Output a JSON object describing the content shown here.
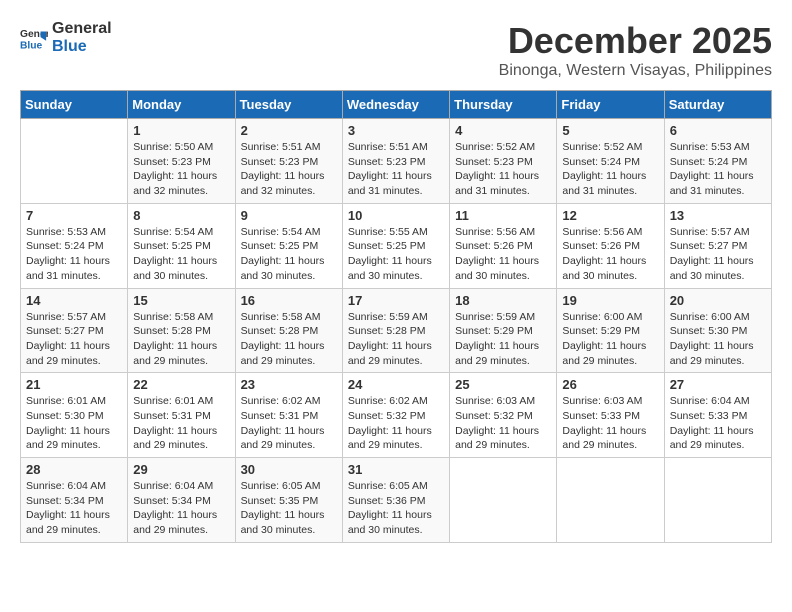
{
  "logo": {
    "line1": "General",
    "line2": "Blue"
  },
  "title": "December 2025",
  "subtitle": "Binonga, Western Visayas, Philippines",
  "weekdays": [
    "Sunday",
    "Monday",
    "Tuesday",
    "Wednesday",
    "Thursday",
    "Friday",
    "Saturday"
  ],
  "weeks": [
    [
      {
        "day": "",
        "sunrise": "",
        "sunset": "",
        "daylight": ""
      },
      {
        "day": "1",
        "sunrise": "Sunrise: 5:50 AM",
        "sunset": "Sunset: 5:23 PM",
        "daylight": "Daylight: 11 hours and 32 minutes."
      },
      {
        "day": "2",
        "sunrise": "Sunrise: 5:51 AM",
        "sunset": "Sunset: 5:23 PM",
        "daylight": "Daylight: 11 hours and 32 minutes."
      },
      {
        "day": "3",
        "sunrise": "Sunrise: 5:51 AM",
        "sunset": "Sunset: 5:23 PM",
        "daylight": "Daylight: 11 hours and 31 minutes."
      },
      {
        "day": "4",
        "sunrise": "Sunrise: 5:52 AM",
        "sunset": "Sunset: 5:23 PM",
        "daylight": "Daylight: 11 hours and 31 minutes."
      },
      {
        "day": "5",
        "sunrise": "Sunrise: 5:52 AM",
        "sunset": "Sunset: 5:24 PM",
        "daylight": "Daylight: 11 hours and 31 minutes."
      },
      {
        "day": "6",
        "sunrise": "Sunrise: 5:53 AM",
        "sunset": "Sunset: 5:24 PM",
        "daylight": "Daylight: 11 hours and 31 minutes."
      }
    ],
    [
      {
        "day": "7",
        "sunrise": "Sunrise: 5:53 AM",
        "sunset": "Sunset: 5:24 PM",
        "daylight": "Daylight: 11 hours and 31 minutes."
      },
      {
        "day": "8",
        "sunrise": "Sunrise: 5:54 AM",
        "sunset": "Sunset: 5:25 PM",
        "daylight": "Daylight: 11 hours and 30 minutes."
      },
      {
        "day": "9",
        "sunrise": "Sunrise: 5:54 AM",
        "sunset": "Sunset: 5:25 PM",
        "daylight": "Daylight: 11 hours and 30 minutes."
      },
      {
        "day": "10",
        "sunrise": "Sunrise: 5:55 AM",
        "sunset": "Sunset: 5:25 PM",
        "daylight": "Daylight: 11 hours and 30 minutes."
      },
      {
        "day": "11",
        "sunrise": "Sunrise: 5:56 AM",
        "sunset": "Sunset: 5:26 PM",
        "daylight": "Daylight: 11 hours and 30 minutes."
      },
      {
        "day": "12",
        "sunrise": "Sunrise: 5:56 AM",
        "sunset": "Sunset: 5:26 PM",
        "daylight": "Daylight: 11 hours and 30 minutes."
      },
      {
        "day": "13",
        "sunrise": "Sunrise: 5:57 AM",
        "sunset": "Sunset: 5:27 PM",
        "daylight": "Daylight: 11 hours and 30 minutes."
      }
    ],
    [
      {
        "day": "14",
        "sunrise": "Sunrise: 5:57 AM",
        "sunset": "Sunset: 5:27 PM",
        "daylight": "Daylight: 11 hours and 29 minutes."
      },
      {
        "day": "15",
        "sunrise": "Sunrise: 5:58 AM",
        "sunset": "Sunset: 5:28 PM",
        "daylight": "Daylight: 11 hours and 29 minutes."
      },
      {
        "day": "16",
        "sunrise": "Sunrise: 5:58 AM",
        "sunset": "Sunset: 5:28 PM",
        "daylight": "Daylight: 11 hours and 29 minutes."
      },
      {
        "day": "17",
        "sunrise": "Sunrise: 5:59 AM",
        "sunset": "Sunset: 5:28 PM",
        "daylight": "Daylight: 11 hours and 29 minutes."
      },
      {
        "day": "18",
        "sunrise": "Sunrise: 5:59 AM",
        "sunset": "Sunset: 5:29 PM",
        "daylight": "Daylight: 11 hours and 29 minutes."
      },
      {
        "day": "19",
        "sunrise": "Sunrise: 6:00 AM",
        "sunset": "Sunset: 5:29 PM",
        "daylight": "Daylight: 11 hours and 29 minutes."
      },
      {
        "day": "20",
        "sunrise": "Sunrise: 6:00 AM",
        "sunset": "Sunset: 5:30 PM",
        "daylight": "Daylight: 11 hours and 29 minutes."
      }
    ],
    [
      {
        "day": "21",
        "sunrise": "Sunrise: 6:01 AM",
        "sunset": "Sunset: 5:30 PM",
        "daylight": "Daylight: 11 hours and 29 minutes."
      },
      {
        "day": "22",
        "sunrise": "Sunrise: 6:01 AM",
        "sunset": "Sunset: 5:31 PM",
        "daylight": "Daylight: 11 hours and 29 minutes."
      },
      {
        "day": "23",
        "sunrise": "Sunrise: 6:02 AM",
        "sunset": "Sunset: 5:31 PM",
        "daylight": "Daylight: 11 hours and 29 minutes."
      },
      {
        "day": "24",
        "sunrise": "Sunrise: 6:02 AM",
        "sunset": "Sunset: 5:32 PM",
        "daylight": "Daylight: 11 hours and 29 minutes."
      },
      {
        "day": "25",
        "sunrise": "Sunrise: 6:03 AM",
        "sunset": "Sunset: 5:32 PM",
        "daylight": "Daylight: 11 hours and 29 minutes."
      },
      {
        "day": "26",
        "sunrise": "Sunrise: 6:03 AM",
        "sunset": "Sunset: 5:33 PM",
        "daylight": "Daylight: 11 hours and 29 minutes."
      },
      {
        "day": "27",
        "sunrise": "Sunrise: 6:04 AM",
        "sunset": "Sunset: 5:33 PM",
        "daylight": "Daylight: 11 hours and 29 minutes."
      }
    ],
    [
      {
        "day": "28",
        "sunrise": "Sunrise: 6:04 AM",
        "sunset": "Sunset: 5:34 PM",
        "daylight": "Daylight: 11 hours and 29 minutes."
      },
      {
        "day": "29",
        "sunrise": "Sunrise: 6:04 AM",
        "sunset": "Sunset: 5:34 PM",
        "daylight": "Daylight: 11 hours and 29 minutes."
      },
      {
        "day": "30",
        "sunrise": "Sunrise: 6:05 AM",
        "sunset": "Sunset: 5:35 PM",
        "daylight": "Daylight: 11 hours and 30 minutes."
      },
      {
        "day": "31",
        "sunrise": "Sunrise: 6:05 AM",
        "sunset": "Sunset: 5:36 PM",
        "daylight": "Daylight: 11 hours and 30 minutes."
      },
      {
        "day": "",
        "sunrise": "",
        "sunset": "",
        "daylight": ""
      },
      {
        "day": "",
        "sunrise": "",
        "sunset": "",
        "daylight": ""
      },
      {
        "day": "",
        "sunrise": "",
        "sunset": "",
        "daylight": ""
      }
    ]
  ]
}
